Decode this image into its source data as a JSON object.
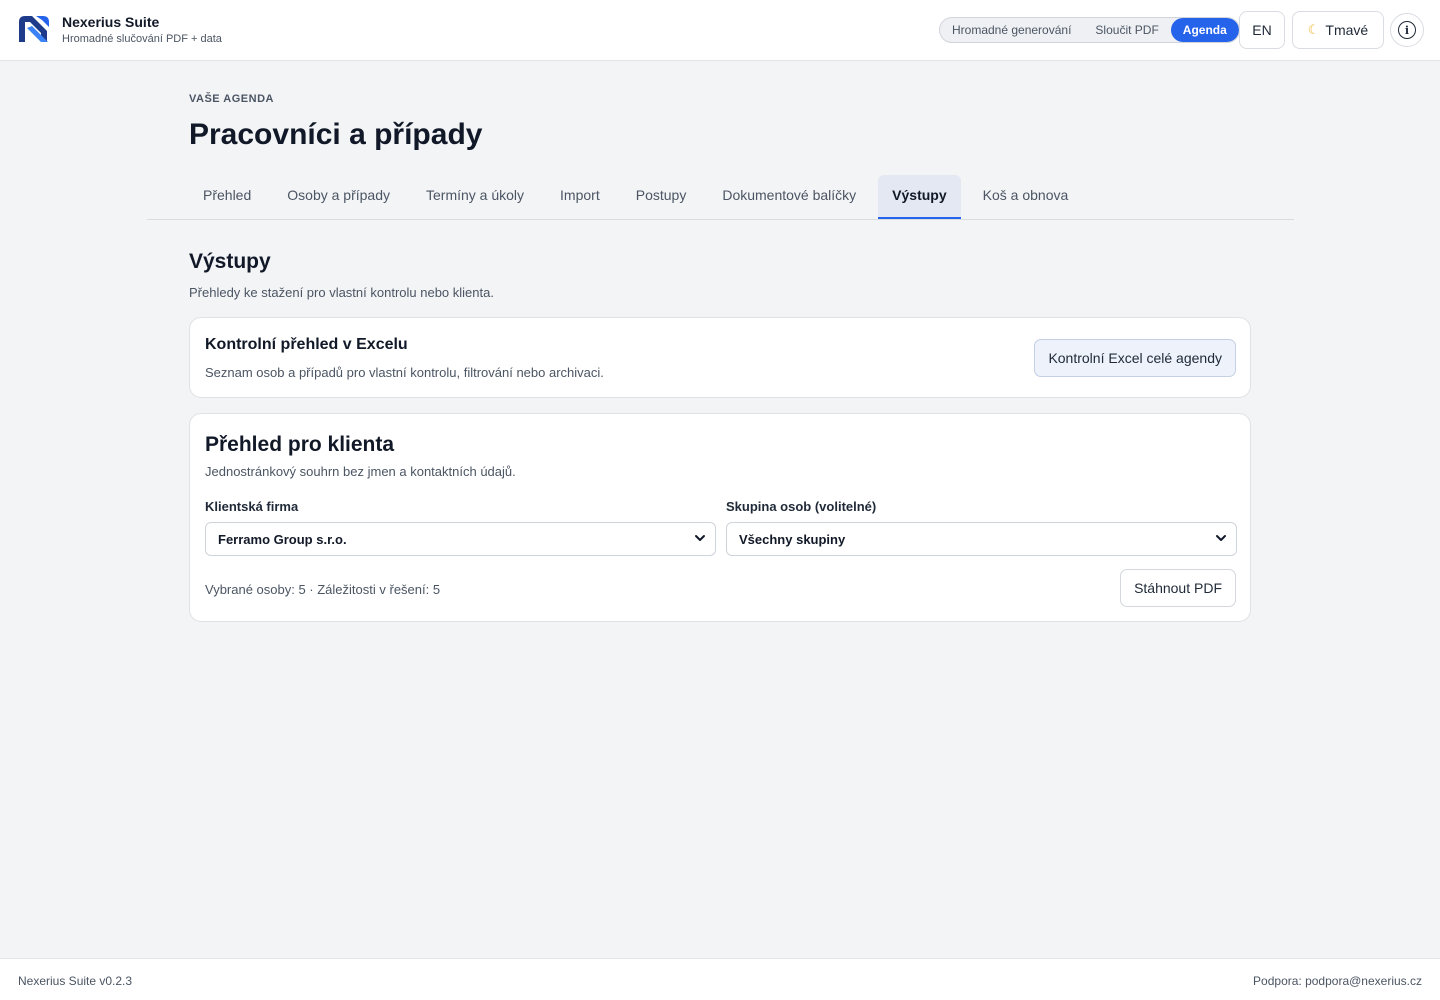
{
  "app": {
    "name": "Nexerius Suite",
    "subtitle": "Hromadné slučování PDF + data",
    "logo_icon": "nexerius-logo-icon"
  },
  "header": {
    "modes": [
      {
        "label": "Hromadné generování",
        "active": false
      },
      {
        "label": "Sloučit PDF",
        "active": false
      },
      {
        "label": "Agenda",
        "active": true
      }
    ],
    "language_label": "EN",
    "theme": {
      "icon": "moon-icon",
      "label": "Tmavé"
    },
    "info_icon": "info-icon"
  },
  "page": {
    "eyebrow": "VAŠE AGENDA",
    "title": "Pracovníci a případy"
  },
  "tabs": [
    {
      "label": "Přehled",
      "active": false
    },
    {
      "label": "Osoby a případy",
      "active": false
    },
    {
      "label": "Termíny a úkoly",
      "active": false
    },
    {
      "label": "Import",
      "active": false
    },
    {
      "label": "Postupy",
      "active": false
    },
    {
      "label": "Dokumentové balíčky",
      "active": false
    },
    {
      "label": "Výstupy",
      "active": true
    },
    {
      "label": "Koš a obnova",
      "active": false
    }
  ],
  "section": {
    "title": "Výstupy",
    "subtitle": "Přehledy ke stažení pro vlastní kontrolu nebo klienta."
  },
  "excel_card": {
    "title": "Kontrolní přehled v Excelu",
    "description": "Seznam osob a případů pro vlastní kontrolu, filtrování nebo archivaci.",
    "button_label": "Kontrolní Excel celé agendy"
  },
  "client_card": {
    "title": "Přehled pro klienta",
    "description": "Jednostránkový souhrn bez jmen a kontaktních údajů.",
    "company_label": "Klientská firma",
    "company_value": "Ferramo Group s.r.o.",
    "group_label": "Skupina osob (volitelné)",
    "group_value": "Všechny skupiny",
    "stats": "Vybrané osoby: 5 · Záležitosti v řešení: 5",
    "download_label": "Stáhnout PDF"
  },
  "footer": {
    "version": "Nexerius Suite v0.2.3",
    "support": "Podpora: podpora@nexerius.cz"
  },
  "colors": {
    "accent": "#2563eb",
    "background": "#f3f4f6",
    "surface": "#ffffff",
    "text_primary": "#111827",
    "text_secondary": "#4b5563"
  }
}
